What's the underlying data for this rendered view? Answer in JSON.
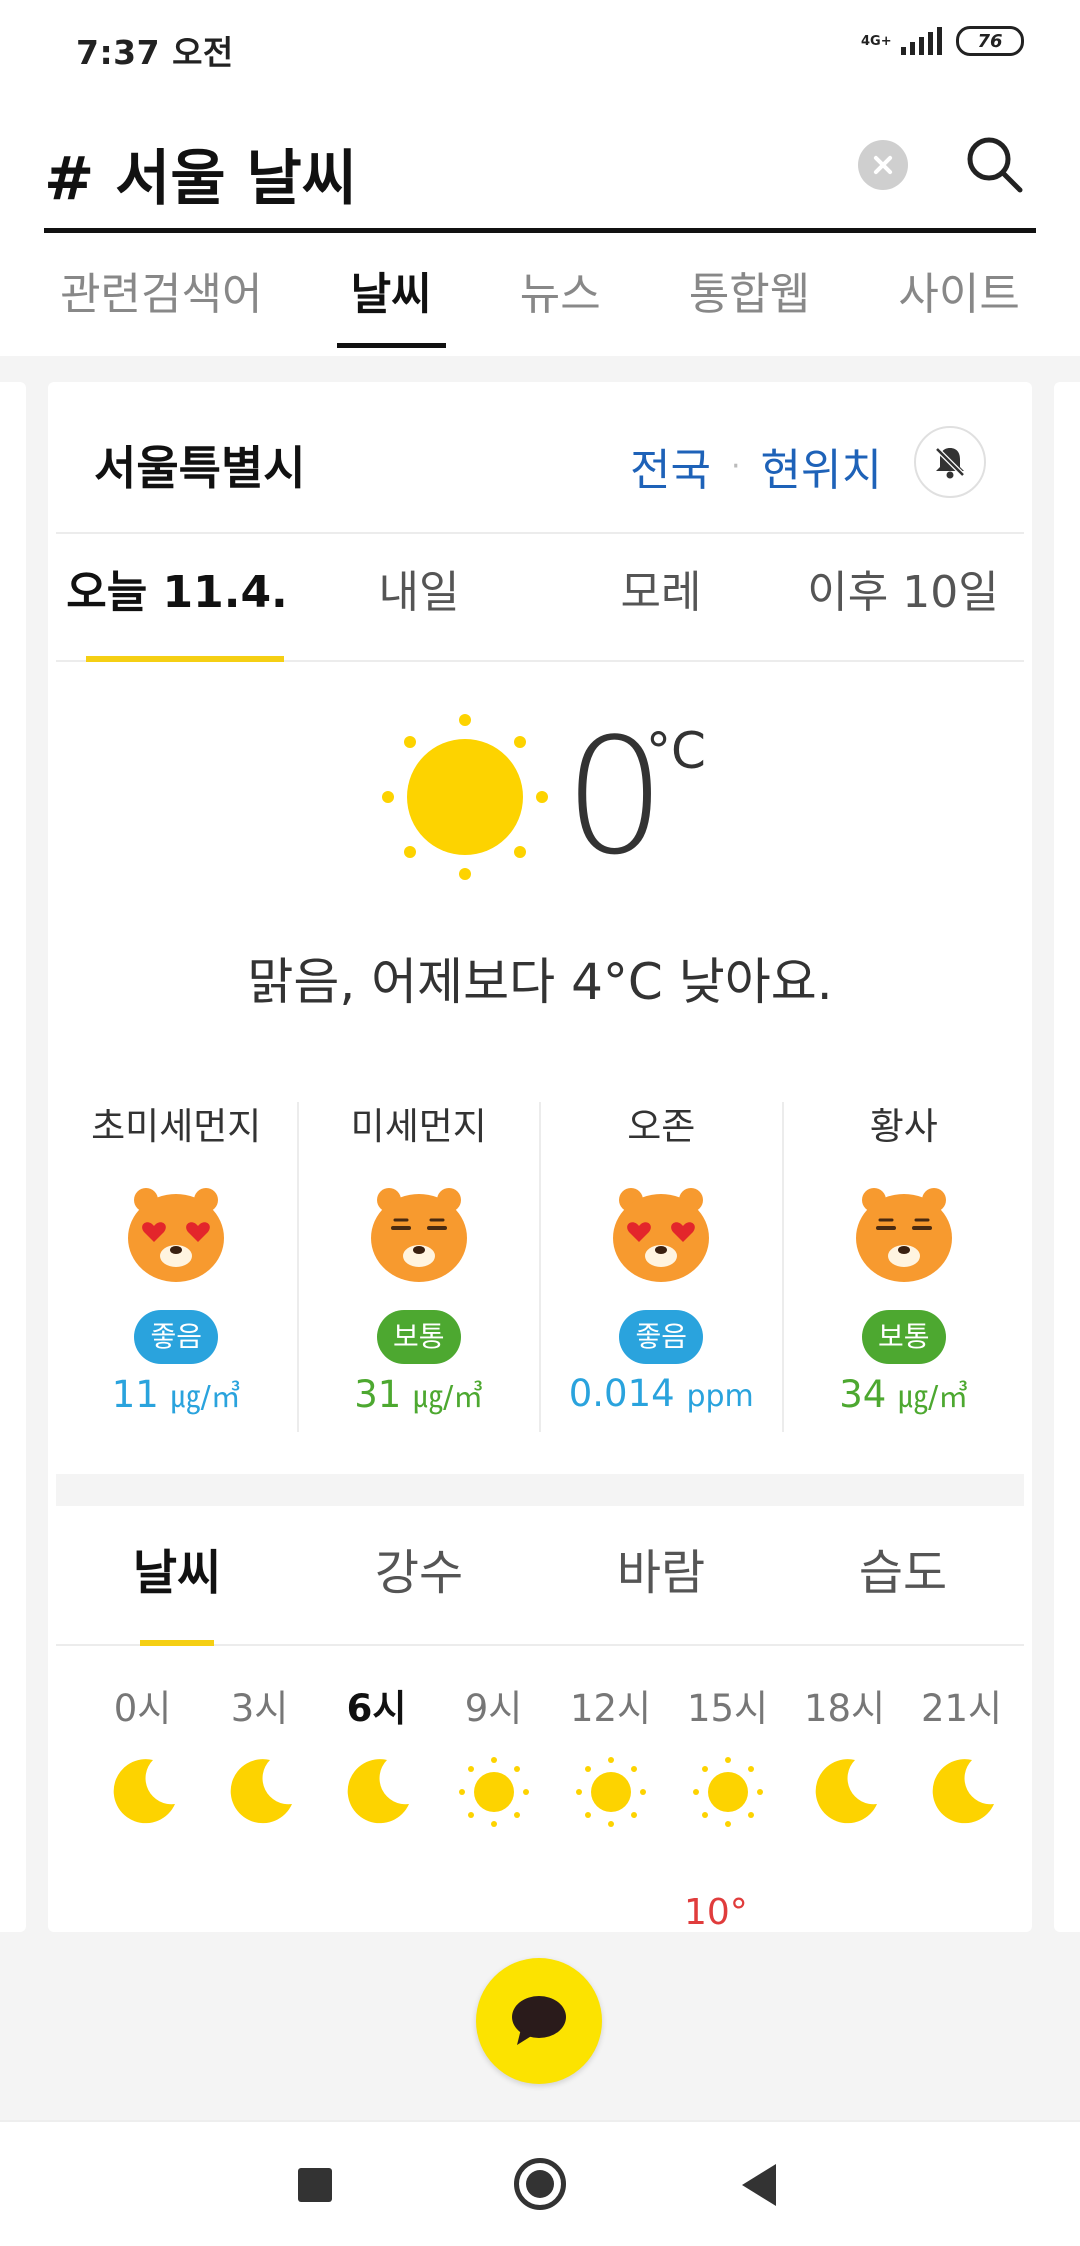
{
  "status_bar": {
    "time": "7:37 오전",
    "network": "4G+",
    "battery": "76"
  },
  "search": {
    "query": "# 서울 날씨"
  },
  "tabs": [
    {
      "label": "관련검색어"
    },
    {
      "label": "날씨"
    },
    {
      "label": "뉴스"
    },
    {
      "label": "통합웹"
    },
    {
      "label": "사이트"
    }
  ],
  "weather": {
    "region": "서울특별시",
    "link_nationwide": "전국",
    "link_current_location": "현위치",
    "separator": "·",
    "days": [
      {
        "label": "오늘 11.4."
      },
      {
        "label": "내일"
      },
      {
        "label": "모레"
      },
      {
        "label": "이후 10일"
      }
    ],
    "current": {
      "temp": "0",
      "unit": "°C",
      "condition_icon": "sun-icon",
      "description": "맑음, 어제보다 4°C 낮아요."
    },
    "air": [
      {
        "label": "초미세먼지",
        "face": "heart-eyes-face-icon",
        "status": "좋음",
        "value": "11",
        "unit": "㎍/㎥",
        "level": "good"
      },
      {
        "label": "미세먼지",
        "face": "neutral-face-icon",
        "status": "보통",
        "value": "31",
        "unit": "㎍/㎥",
        "level": "normal"
      },
      {
        "label": "오존",
        "face": "heart-eyes-face-icon",
        "status": "좋음",
        "value": "0.014",
        "unit": "ppm",
        "level": "good"
      },
      {
        "label": "황사",
        "face": "neutral-face-icon",
        "status": "보통",
        "value": "34",
        "unit": "㎍/㎥",
        "level": "normal"
      }
    ],
    "forecast_tabs": [
      {
        "label": "날씨"
      },
      {
        "label": "강수"
      },
      {
        "label": "바람"
      },
      {
        "label": "습도"
      }
    ],
    "hourly": [
      {
        "label": "0시",
        "icon": "moon-icon"
      },
      {
        "label": "3시",
        "icon": "moon-icon"
      },
      {
        "label": "6시",
        "icon": "moon-icon"
      },
      {
        "label": "9시",
        "icon": "sun-icon"
      },
      {
        "label": "12시",
        "icon": "sun-icon"
      },
      {
        "label": "15시",
        "icon": "sun-icon"
      },
      {
        "label": "18시",
        "icon": "moon-icon"
      },
      {
        "label": "21시",
        "icon": "moon-icon"
      }
    ],
    "temp_peek": "10°"
  },
  "colors": {
    "accent_yellow": "#f5cf14",
    "link_blue": "#1e62b8",
    "good": "#2aa3dd",
    "normal": "#4da830",
    "hot": "#e03c3c",
    "talk_yellow": "#fce300"
  }
}
